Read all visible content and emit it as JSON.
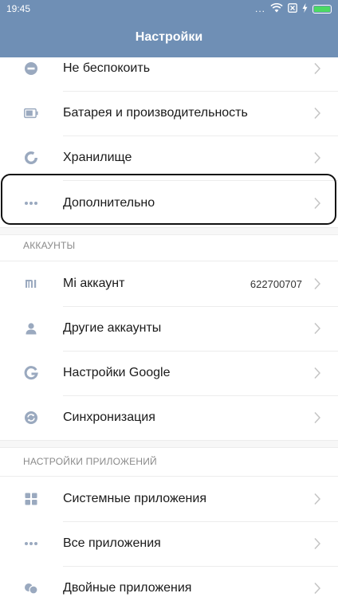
{
  "status_bar": {
    "time": "19:45",
    "dots": "...",
    "icons": [
      "wifi-icon",
      "sim-x-icon",
      "charging-icon",
      "battery-icon"
    ],
    "battery_level": 1.0,
    "battery_color": "#4cd964"
  },
  "header": {
    "title": "Настройки",
    "color": "#6f8fb5"
  },
  "rows_top": [
    {
      "label": "Не беспокоить",
      "icon": "do-not-disturb-icon"
    },
    {
      "label": "Батарея и производительность",
      "icon": "battery-icon"
    },
    {
      "label": "Хранилище",
      "icon": "storage-icon"
    },
    {
      "label": "Дополнительно",
      "icon": "more-dots-icon"
    }
  ],
  "accounts": {
    "header": "АККАУНТЫ",
    "items": [
      {
        "label": "Mi аккаунт",
        "value": "622700707",
        "icon": "mi-logo-icon"
      },
      {
        "label": "Другие аккаунты",
        "icon": "person-icon"
      },
      {
        "label": "Настройки Google",
        "icon": "google-icon"
      },
      {
        "label": "Синхронизация",
        "icon": "sync-icon"
      }
    ]
  },
  "apps": {
    "header": "НАСТРОЙКИ ПРИЛОЖЕНИЙ",
    "items": [
      {
        "label": "Системные приложения",
        "icon": "grid-icon"
      },
      {
        "label": "Все приложения",
        "icon": "more-dots-icon"
      },
      {
        "label": "Двойные приложения",
        "icon": "dual-apps-icon"
      }
    ]
  },
  "icon_color": "#9aa9bf",
  "chevron_color": "#c4c4c4"
}
